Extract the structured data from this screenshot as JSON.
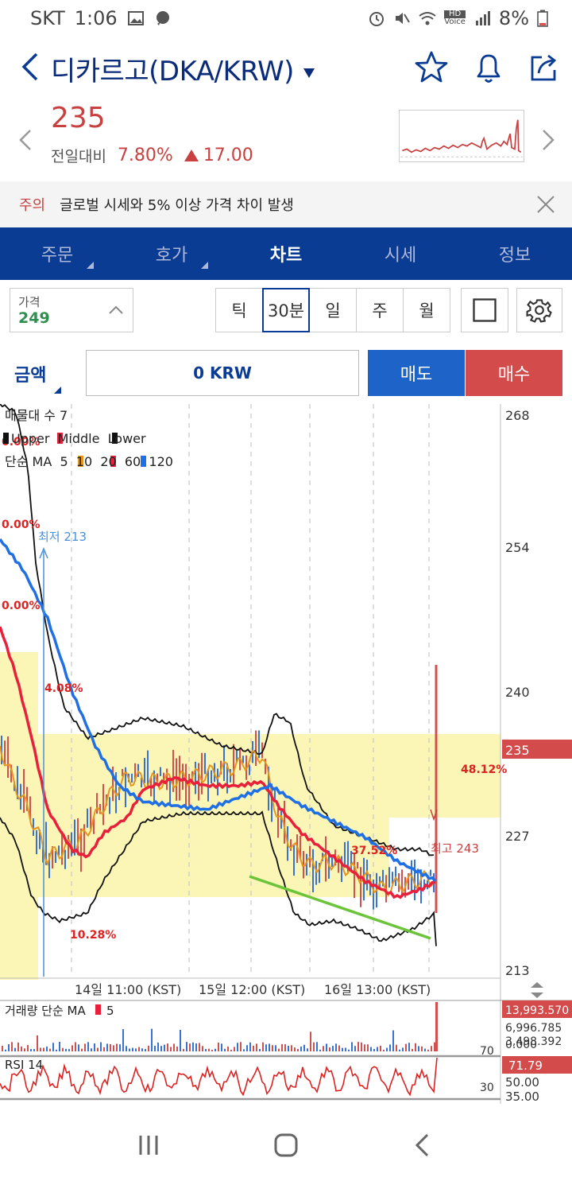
{
  "status": {
    "carrier": "SKT",
    "time": "1:06",
    "battery": "8%",
    "hd_label": "HD",
    "voice_label": "Voice"
  },
  "header": {
    "title": "디카르고(DKA/KRW)"
  },
  "price": {
    "current": "235",
    "prev_label": "전일대비",
    "change_pct": "7.80%",
    "change_abs": "17.00"
  },
  "warning": {
    "tag": "주의",
    "text": "글로벌 시세와 5% 이상 가격 차이 발생"
  },
  "tabs": [
    {
      "label": "주문",
      "active": false,
      "corner": true
    },
    {
      "label": "호가",
      "active": false,
      "corner": true
    },
    {
      "label": "차트",
      "active": true,
      "corner": false
    },
    {
      "label": "시세",
      "active": false,
      "corner": false
    },
    {
      "label": "정보",
      "active": false,
      "corner": false
    }
  ],
  "controls": {
    "price_label": "가격",
    "price_value": "249",
    "periods": [
      {
        "label": "틱",
        "active": false
      },
      {
        "label": "30분",
        "active": true
      },
      {
        "label": "일",
        "active": false
      },
      {
        "label": "주",
        "active": false
      },
      {
        "label": "월",
        "active": false
      }
    ]
  },
  "order": {
    "amount_label": "금액",
    "amount_value": "0 KRW",
    "sell_label": "매도",
    "buy_label": "매수"
  },
  "colors": {
    "navy": "#0b3c94",
    "red": "#d34b4b",
    "blue": "#1e63c8",
    "up": "#c94040",
    "green": "#2f8f4f",
    "ma5": "#e69522",
    "ma20": "#e8203c",
    "ma60": "#1f6fe5",
    "trend": "#6cc43a",
    "zone": "#fbf6b5"
  },
  "chart_data": {
    "type": "candlestick",
    "legend_lines": [
      "매물대 수 7",
      "Upper  Middle  Lower",
      "단순 MA  5  10  20  60  120"
    ],
    "price_axis": [
      "268",
      "254",
      "240",
      "235",
      "227",
      "213"
    ],
    "current_price_tag": "235",
    "time_labels": [
      "14일 11:00 (KST)",
      "15일 12:00 (KST)",
      "16일 13:00 (KST)"
    ],
    "annotations": {
      "low_label": "최저 213",
      "high_label": "최고 243",
      "pct_labels": [
        "0.00%",
        "0.00%",
        "0.00%",
        "4.08%",
        "10.28%",
        "37.52%",
        "48.12%"
      ]
    },
    "volume": {
      "label": "거래량 단순 MA",
      "period": "5",
      "axis": [
        "13,993.570",
        "6,996.785",
        "3,498.392",
        "0.000"
      ]
    },
    "rsi": {
      "label": "RSI 14",
      "levels": [
        "70",
        "30"
      ],
      "current": "71.79",
      "axis": [
        "50.00",
        "35.00"
      ]
    },
    "ylim": [
      213,
      268
    ]
  }
}
